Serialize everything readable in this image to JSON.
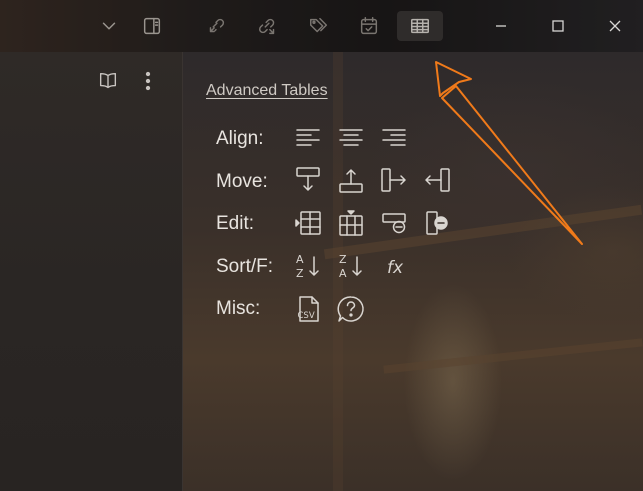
{
  "panel": {
    "title": "Advanced Tables",
    "rows": [
      {
        "label": "Align:",
        "tools": [
          "align-left-icon",
          "align-center-icon",
          "align-right-icon"
        ]
      },
      {
        "label": "Move:",
        "tools": [
          "move-row-down-icon",
          "move-row-up-icon",
          "move-column-right-icon",
          "move-column-left-icon"
        ]
      },
      {
        "label": "Edit:",
        "tools": [
          "insert-row-icon",
          "insert-column-icon",
          "delete-row-icon",
          "delete-column-icon"
        ]
      },
      {
        "label": "Sort/F:",
        "tools": [
          "sort-ascending-icon",
          "sort-descending-icon",
          "formula-icon"
        ]
      },
      {
        "label": "Misc:",
        "tools": [
          "csv-export-icon",
          "help-icon"
        ]
      }
    ],
    "csv_text": "CSV",
    "sort_asc_top": "A",
    "sort_asc_bottom": "Z",
    "sort_desc_top": "Z",
    "sort_desc_bottom": "A",
    "formula_text": "fx"
  },
  "toolbar": {
    "icons": [
      "chevron-down-icon",
      "sidebar-toggle-icon",
      "backlinks-icon",
      "outgoing-links-icon",
      "tags-icon",
      "calendar-icon",
      "advanced-tables-icon"
    ],
    "active": "advanced-tables-icon"
  },
  "window_controls": [
    "minimize-icon",
    "maximize-icon",
    "close-icon"
  ],
  "left_pane": {
    "icons": [
      "reading-view-icon",
      "more-options-icon"
    ]
  },
  "colors": {
    "annotation_arrow": "#f07a1a",
    "text": "#e8e4df",
    "title": "#cfcac4"
  }
}
